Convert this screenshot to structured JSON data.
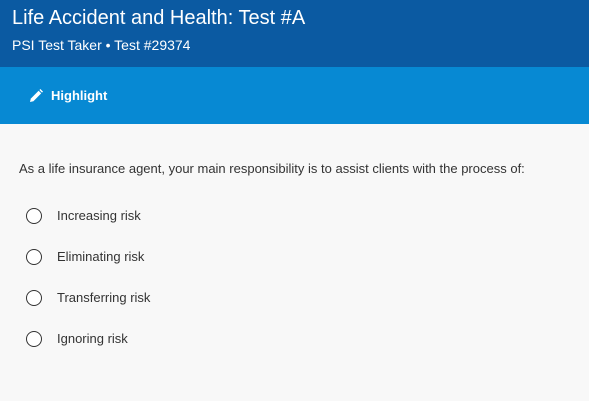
{
  "header": {
    "title": "Life Accident and Health: Test #A",
    "subtitle": "PSI Test Taker • Test #29374"
  },
  "toolbar": {
    "highlight_label": "Highlight",
    "highlight_icon": "pencil-icon"
  },
  "question": {
    "text": "As a life insurance agent, your main responsibility is to assist clients with the process of:",
    "choices": [
      {
        "label": "Increasing risk",
        "selected": false
      },
      {
        "label": "Eliminating risk",
        "selected": false
      },
      {
        "label": "Transferring risk",
        "selected": false
      },
      {
        "label": "Ignoring risk",
        "selected": false
      }
    ]
  },
  "colors": {
    "header_bg": "#0b5aa2",
    "toolbar_bg": "#0789d3",
    "page_bg": "#f8f8f8"
  }
}
